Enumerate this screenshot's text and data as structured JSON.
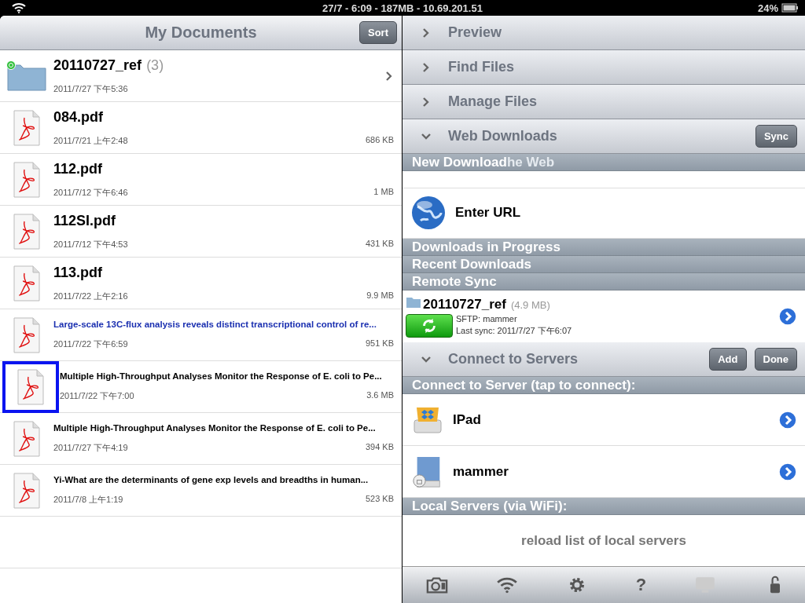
{
  "status_bar": {
    "center": "27/7 - 6:09 - 187MB - 10.69.201.51",
    "battery": "24%"
  },
  "documents": {
    "title": "My Documents",
    "sort_button": "Sort",
    "items": [
      {
        "kind": "folder",
        "name": "20110727_ref",
        "count": "(3)",
        "date": "2011/7/27 下午5:36",
        "synced": true,
        "highlighted": false,
        "link": false
      },
      {
        "kind": "pdf",
        "name": "084.pdf",
        "date": "2011/7/21 上午2:48",
        "size": "686 KB",
        "highlighted": false,
        "link": false
      },
      {
        "kind": "pdf",
        "name": "112.pdf",
        "date": "2011/7/12 下午6:46",
        "size": "1 MB",
        "highlighted": false,
        "link": false
      },
      {
        "kind": "pdf",
        "name": "112SI.pdf",
        "date": "2011/7/12 下午4:53",
        "size": "431 KB",
        "highlighted": false,
        "link": false
      },
      {
        "kind": "pdf",
        "name": "113.pdf",
        "date": "2011/7/22 上午2:16",
        "size": "9.9 MB",
        "highlighted": false,
        "link": false
      },
      {
        "kind": "pdf",
        "name": "Large-scale 13C-flux analysis reveals distinct transcriptional control of re...",
        "date": "2011/7/22 下午6:59",
        "size": "951 KB",
        "highlighted": false,
        "link": true
      },
      {
        "kind": "pdf",
        "name": "Multiple High-Throughput Analyses Monitor the Response of E. coli to Pe...",
        "date": "2011/7/22 下午7:00",
        "size": "3.6 MB",
        "highlighted": true,
        "link": false
      },
      {
        "kind": "pdf",
        "name": "Multiple High-Throughput Analyses Monitor the Response of E. coli to Pe...",
        "date": "2011/7/27 下午4:19",
        "size": "394 KB",
        "highlighted": false,
        "link": false
      },
      {
        "kind": "pdf",
        "name": "Yi-What are the determinants of gene exp levels and breadths in human...",
        "date": "2011/7/8 上午1:19",
        "size": "523 KB",
        "highlighted": false,
        "link": false
      }
    ]
  },
  "accordion": [
    {
      "label": "Preview",
      "expanded": false
    },
    {
      "label": "Find Files",
      "expanded": false
    },
    {
      "label": "Manage Files",
      "expanded": false
    },
    {
      "label": "Web Downloads",
      "expanded": true,
      "button": "Sync"
    }
  ],
  "web_downloads": {
    "new_download_header": "New Download",
    "covered_row_text": "he Web",
    "enter_url": "Enter URL",
    "in_progress_header": "Downloads in Progress",
    "recent_header": "Recent Downloads",
    "remote_sync_header": "Remote Sync",
    "sync_item": {
      "name": "20110727_ref",
      "size": "(4.9 MB)",
      "server": "SFTP: mammer",
      "last_sync": "Last sync: 2011/7/27 下午6:07"
    }
  },
  "connect": {
    "label": "Connect to Servers",
    "expanded": true,
    "buttons": [
      "Add",
      "Done"
    ],
    "servers_header": "Connect to Server (tap to connect):",
    "servers": [
      {
        "kind": "dropbox",
        "name": "IPad"
      },
      {
        "kind": "disk",
        "name": "mammer"
      }
    ],
    "local_header": "Local Servers (via WiFi):",
    "reload": "reload list of local servers"
  },
  "toolbar": [
    {
      "kind": "camera",
      "disabled": false
    },
    {
      "kind": "wifi",
      "disabled": false
    },
    {
      "kind": "gear",
      "disabled": false
    },
    {
      "kind": "help",
      "glyph": "?",
      "disabled": false
    },
    {
      "kind": "monitor",
      "disabled": true
    },
    {
      "kind": "lock",
      "disabled": false
    }
  ]
}
